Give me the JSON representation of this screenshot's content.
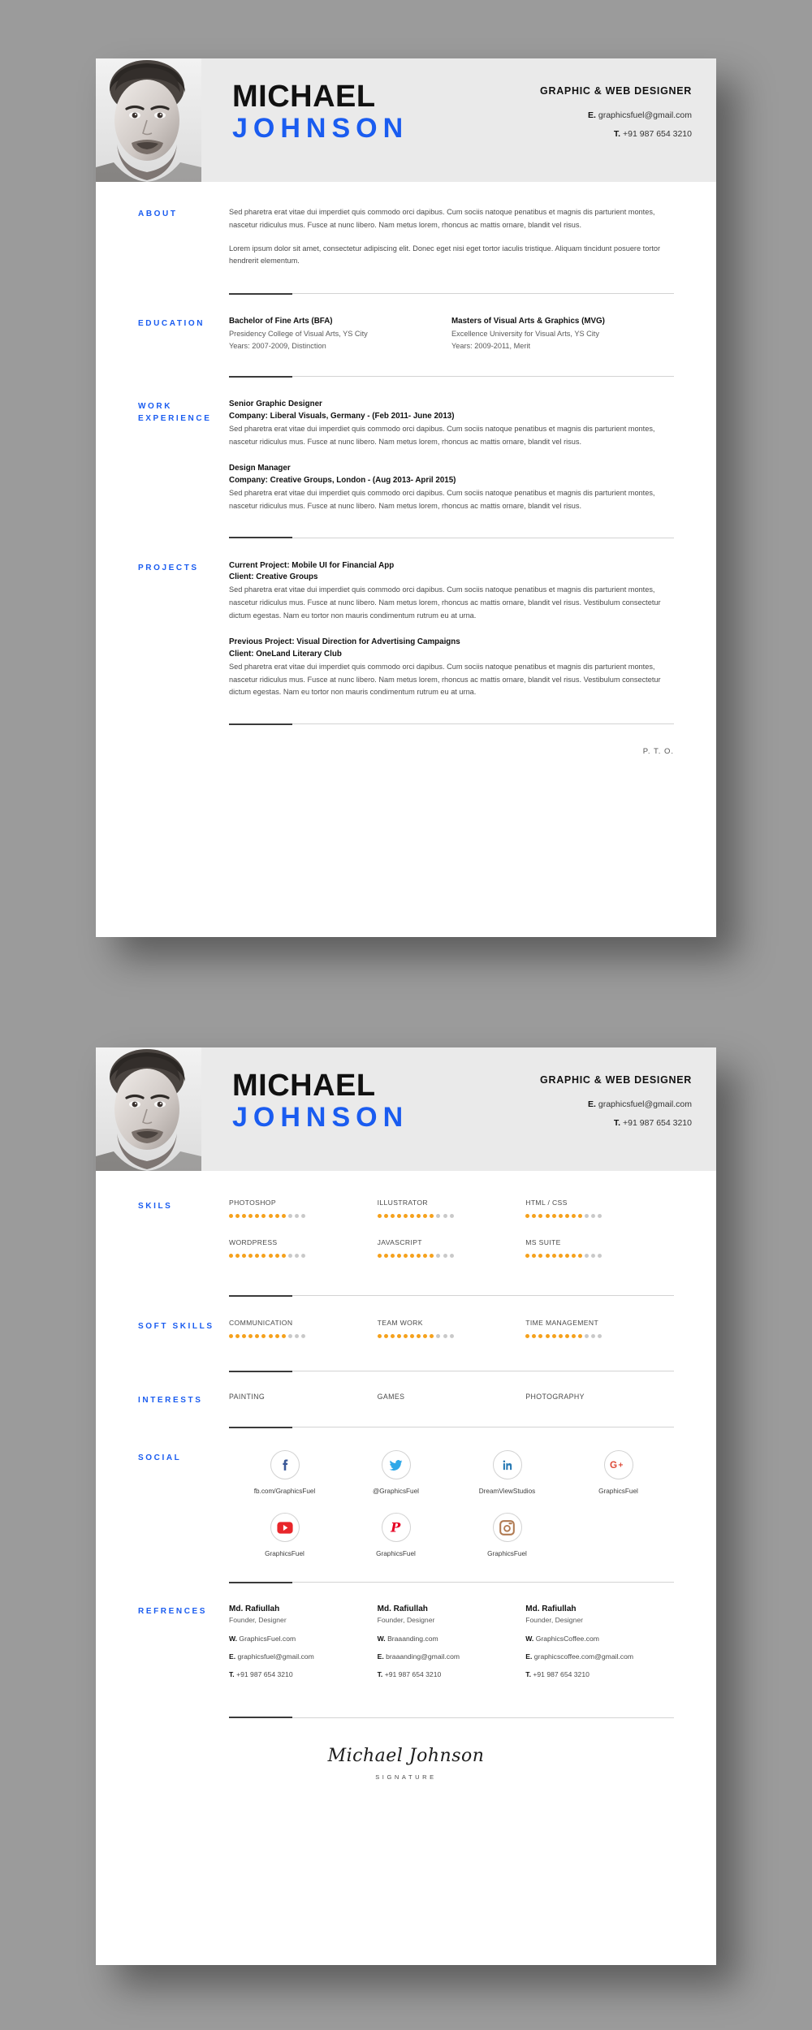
{
  "header": {
    "name_first": "MICHAEL",
    "name_last": "JOHNSON",
    "job_title": "GRAPHIC & WEB DESIGNER",
    "email_label": "E.",
    "email": "graphicsfuel@gmail.com",
    "phone_label": "T.",
    "phone": "+91 987 654 3210",
    "photo_alt": "portrait-photo"
  },
  "accent_color": "#1a5cf0",
  "dot_on_color": "#f5a11c",
  "dot_off_color": "#c9c9c9",
  "page1": {
    "about": {
      "label": "ABOUT",
      "paragraphs": [
        "Sed pharetra erat vitae dui imperdiet quis commodo orci dapibus. Cum sociis natoque penatibus et magnis dis parturient montes, nascetur ridiculus mus. Fusce at nunc libero. Nam metus lorem, rhoncus ac mattis ornare, blandit vel risus.",
        "Lorem ipsum dolor sit amet, consectetur adipiscing elit. Donec eget nisi eget tortor iaculis tristique. Aliquam tincidunt posuere tortor hendrerit elementum."
      ]
    },
    "education": {
      "label": "EDUCATION",
      "items": [
        {
          "degree": "Bachelor of Fine Arts (BFA)",
          "school": "Presidency College of Visual Arts, YS City",
          "years": "Years: 2007-2009,  Distinction"
        },
        {
          "degree": "Masters of Visual Arts & Graphics (MVG)",
          "school": "Excellence University for Visual Arts, YS City",
          "years": "Years: 2009-2011, Merit"
        }
      ]
    },
    "work": {
      "label": "WORK EXPERIENCE",
      "label_line1": "WORK",
      "label_line2": "EXPERIENCE",
      "items": [
        {
          "role": "Senior Graphic Designer",
          "company": "Company: Liberal Visuals, Germany -  (Feb 2011- June 2013)",
          "desc": "Sed pharetra erat vitae dui imperdiet quis commodo orci dapibus. Cum sociis natoque penatibus et magnis dis parturient montes, nascetur ridiculus mus. Fusce at nunc libero. Nam metus lorem, rhoncus ac mattis ornare, blandit vel risus."
        },
        {
          "role": "Design Manager",
          "company": "Company: Creative Groups, London -  (Aug 2013- April 2015)",
          "desc": "Sed pharetra erat vitae dui imperdiet quis commodo orci dapibus. Cum sociis natoque penatibus et magnis dis parturient montes, nascetur ridiculus mus. Fusce at nunc libero. Nam metus lorem, rhoncus ac mattis ornare, blandit vel risus."
        }
      ]
    },
    "projects": {
      "label": "PROJECTS",
      "items": [
        {
          "title": "Current Project:   Mobile UI for Financial App",
          "client": "Client: Creative Groups",
          "desc": "Sed pharetra erat vitae dui imperdiet quis commodo orci dapibus. Cum sociis natoque penatibus et magnis dis parturient montes, nascetur ridiculus mus. Fusce at nunc libero. Nam metus lorem, rhoncus ac mattis ornare, blandit vel risus. Vestibulum consectetur dictum egestas. Nam eu tortor non mauris condimentum rutrum eu at urna."
        },
        {
          "title": "Previous Project:   Visual Direction for Advertising Campaigns",
          "client": "Client: OneLand Literary Club",
          "desc": "Sed pharetra erat vitae dui imperdiet quis commodo orci dapibus. Cum sociis natoque penatibus et magnis dis parturient montes, nascetur ridiculus mus. Fusce at nunc libero. Nam metus lorem, rhoncus ac mattis ornare, blandit vel risus. Vestibulum consectetur dictum egestas. Nam eu tortor non mauris condimentum rutrum eu at urna."
        }
      ]
    },
    "pto": "P. T. O."
  },
  "page2": {
    "skills": {
      "label": "SKILS",
      "total_dots": 12,
      "items": [
        {
          "name": "PHOTOSHOP",
          "filled": 9
        },
        {
          "name": "ILLUSTRATOR",
          "filled": 9
        },
        {
          "name": "HTML / CSS",
          "filled": 9
        },
        {
          "name": "WORDPRESS",
          "filled": 9
        },
        {
          "name": "JAVASCRIPT",
          "filled": 9
        },
        {
          "name": "MS SUITE",
          "filled": 9
        }
      ]
    },
    "soft_skills": {
      "label": "SOFT SKILLS",
      "total_dots": 12,
      "items": [
        {
          "name": "COMMUNICATION",
          "filled": 9
        },
        {
          "name": "TEAM WORK",
          "filled": 9
        },
        {
          "name": "TIME MANAGEMENT",
          "filled": 9
        }
      ]
    },
    "interests": {
      "label": "INTERESTS",
      "items": [
        "PAINTING",
        "GAMES",
        "PHOTOGRAPHY"
      ]
    },
    "social": {
      "label": "SOCIAL",
      "items": [
        {
          "icon": "facebook-icon",
          "label": "fb.com/GraphicsFuel",
          "color": "#3b5998"
        },
        {
          "icon": "twitter-icon",
          "label": "@GraphicsFuel",
          "color": "#2fa8e8"
        },
        {
          "icon": "linkedin-icon",
          "label": "DreamViewStudios",
          "color": "#2a7bb5"
        },
        {
          "icon": "googleplus-icon",
          "label": "GraphicsFuel",
          "color": "#dd4b39"
        },
        {
          "icon": "youtube-icon",
          "label": "GraphicsFuel",
          "color": "#e8262a"
        },
        {
          "icon": "pinterest-icon",
          "label": "GraphicsFuel",
          "color": "#e60023"
        },
        {
          "icon": "instagram-icon",
          "label": "GraphicsFuel",
          "color": "#b07a52"
        }
      ]
    },
    "references": {
      "label": "REFRENCES",
      "items": [
        {
          "name": "Md. Rafiullah",
          "role": "Founder, Designer",
          "w_label": "W.",
          "web": "GraphicsFuel.com",
          "e_label": "E.",
          "email": "graphicsfuel@gmail.com",
          "t_label": "T.",
          "phone": "+91 987 654 3210"
        },
        {
          "name": "Md. Rafiullah",
          "role": "Founder, Designer",
          "w_label": "W.",
          "web": "Braaanding.com",
          "e_label": "E.",
          "email": "braaanding@gmail.com",
          "t_label": "T.",
          "phone": "+91 987 654 3210"
        },
        {
          "name": "Md. Rafiullah",
          "role": "Founder, Designer",
          "w_label": "W.",
          "web": "GraphicsCoffee.com",
          "e_label": "E.",
          "email": "graphicscoffee.com@gmail.com",
          "t_label": "T.",
          "phone": "+91 987 654 3210"
        }
      ]
    },
    "signature": {
      "name": "Michael Johnson",
      "caption": "SIGNATURE"
    }
  }
}
